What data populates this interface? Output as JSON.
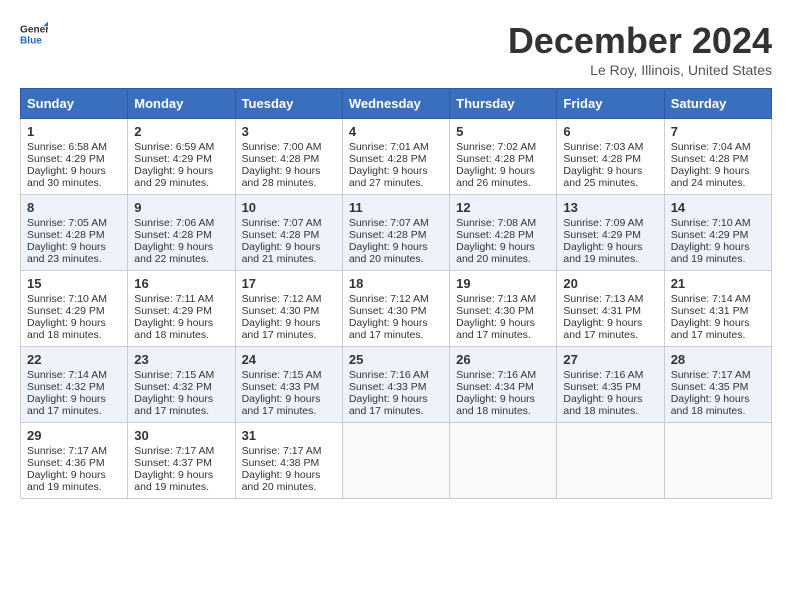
{
  "header": {
    "logo_general": "General",
    "logo_blue": "Blue",
    "month_title": "December 2024",
    "location": "Le Roy, Illinois, United States"
  },
  "days_of_week": [
    "Sunday",
    "Monday",
    "Tuesday",
    "Wednesday",
    "Thursday",
    "Friday",
    "Saturday"
  ],
  "weeks": [
    [
      {
        "day": "1",
        "sunrise": "6:58 AM",
        "sunset": "4:29 PM",
        "daylight": "9 hours and 30 minutes."
      },
      {
        "day": "2",
        "sunrise": "6:59 AM",
        "sunset": "4:29 PM",
        "daylight": "9 hours and 29 minutes."
      },
      {
        "day": "3",
        "sunrise": "7:00 AM",
        "sunset": "4:28 PM",
        "daylight": "9 hours and 28 minutes."
      },
      {
        "day": "4",
        "sunrise": "7:01 AM",
        "sunset": "4:28 PM",
        "daylight": "9 hours and 27 minutes."
      },
      {
        "day": "5",
        "sunrise": "7:02 AM",
        "sunset": "4:28 PM",
        "daylight": "9 hours and 26 minutes."
      },
      {
        "day": "6",
        "sunrise": "7:03 AM",
        "sunset": "4:28 PM",
        "daylight": "9 hours and 25 minutes."
      },
      {
        "day": "7",
        "sunrise": "7:04 AM",
        "sunset": "4:28 PM",
        "daylight": "9 hours and 24 minutes."
      }
    ],
    [
      {
        "day": "8",
        "sunrise": "7:05 AM",
        "sunset": "4:28 PM",
        "daylight": "9 hours and 23 minutes."
      },
      {
        "day": "9",
        "sunrise": "7:06 AM",
        "sunset": "4:28 PM",
        "daylight": "9 hours and 22 minutes."
      },
      {
        "day": "10",
        "sunrise": "7:07 AM",
        "sunset": "4:28 PM",
        "daylight": "9 hours and 21 minutes."
      },
      {
        "day": "11",
        "sunrise": "7:07 AM",
        "sunset": "4:28 PM",
        "daylight": "9 hours and 20 minutes."
      },
      {
        "day": "12",
        "sunrise": "7:08 AM",
        "sunset": "4:28 PM",
        "daylight": "9 hours and 20 minutes."
      },
      {
        "day": "13",
        "sunrise": "7:09 AM",
        "sunset": "4:29 PM",
        "daylight": "9 hours and 19 minutes."
      },
      {
        "day": "14",
        "sunrise": "7:10 AM",
        "sunset": "4:29 PM",
        "daylight": "9 hours and 19 minutes."
      }
    ],
    [
      {
        "day": "15",
        "sunrise": "7:10 AM",
        "sunset": "4:29 PM",
        "daylight": "9 hours and 18 minutes."
      },
      {
        "day": "16",
        "sunrise": "7:11 AM",
        "sunset": "4:29 PM",
        "daylight": "9 hours and 18 minutes."
      },
      {
        "day": "17",
        "sunrise": "7:12 AM",
        "sunset": "4:30 PM",
        "daylight": "9 hours and 17 minutes."
      },
      {
        "day": "18",
        "sunrise": "7:12 AM",
        "sunset": "4:30 PM",
        "daylight": "9 hours and 17 minutes."
      },
      {
        "day": "19",
        "sunrise": "7:13 AM",
        "sunset": "4:30 PM",
        "daylight": "9 hours and 17 minutes."
      },
      {
        "day": "20",
        "sunrise": "7:13 AM",
        "sunset": "4:31 PM",
        "daylight": "9 hours and 17 minutes."
      },
      {
        "day": "21",
        "sunrise": "7:14 AM",
        "sunset": "4:31 PM",
        "daylight": "9 hours and 17 minutes."
      }
    ],
    [
      {
        "day": "22",
        "sunrise": "7:14 AM",
        "sunset": "4:32 PM",
        "daylight": "9 hours and 17 minutes."
      },
      {
        "day": "23",
        "sunrise": "7:15 AM",
        "sunset": "4:32 PM",
        "daylight": "9 hours and 17 minutes."
      },
      {
        "day": "24",
        "sunrise": "7:15 AM",
        "sunset": "4:33 PM",
        "daylight": "9 hours and 17 minutes."
      },
      {
        "day": "25",
        "sunrise": "7:16 AM",
        "sunset": "4:33 PM",
        "daylight": "9 hours and 17 minutes."
      },
      {
        "day": "26",
        "sunrise": "7:16 AM",
        "sunset": "4:34 PM",
        "daylight": "9 hours and 18 minutes."
      },
      {
        "day": "27",
        "sunrise": "7:16 AM",
        "sunset": "4:35 PM",
        "daylight": "9 hours and 18 minutes."
      },
      {
        "day": "28",
        "sunrise": "7:17 AM",
        "sunset": "4:35 PM",
        "daylight": "9 hours and 18 minutes."
      }
    ],
    [
      {
        "day": "29",
        "sunrise": "7:17 AM",
        "sunset": "4:36 PM",
        "daylight": "9 hours and 19 minutes."
      },
      {
        "day": "30",
        "sunrise": "7:17 AM",
        "sunset": "4:37 PM",
        "daylight": "9 hours and 19 minutes."
      },
      {
        "day": "31",
        "sunrise": "7:17 AM",
        "sunset": "4:38 PM",
        "daylight": "9 hours and 20 minutes."
      },
      null,
      null,
      null,
      null
    ]
  ],
  "labels": {
    "sunrise": "Sunrise:",
    "sunset": "Sunset:",
    "daylight": "Daylight:"
  }
}
